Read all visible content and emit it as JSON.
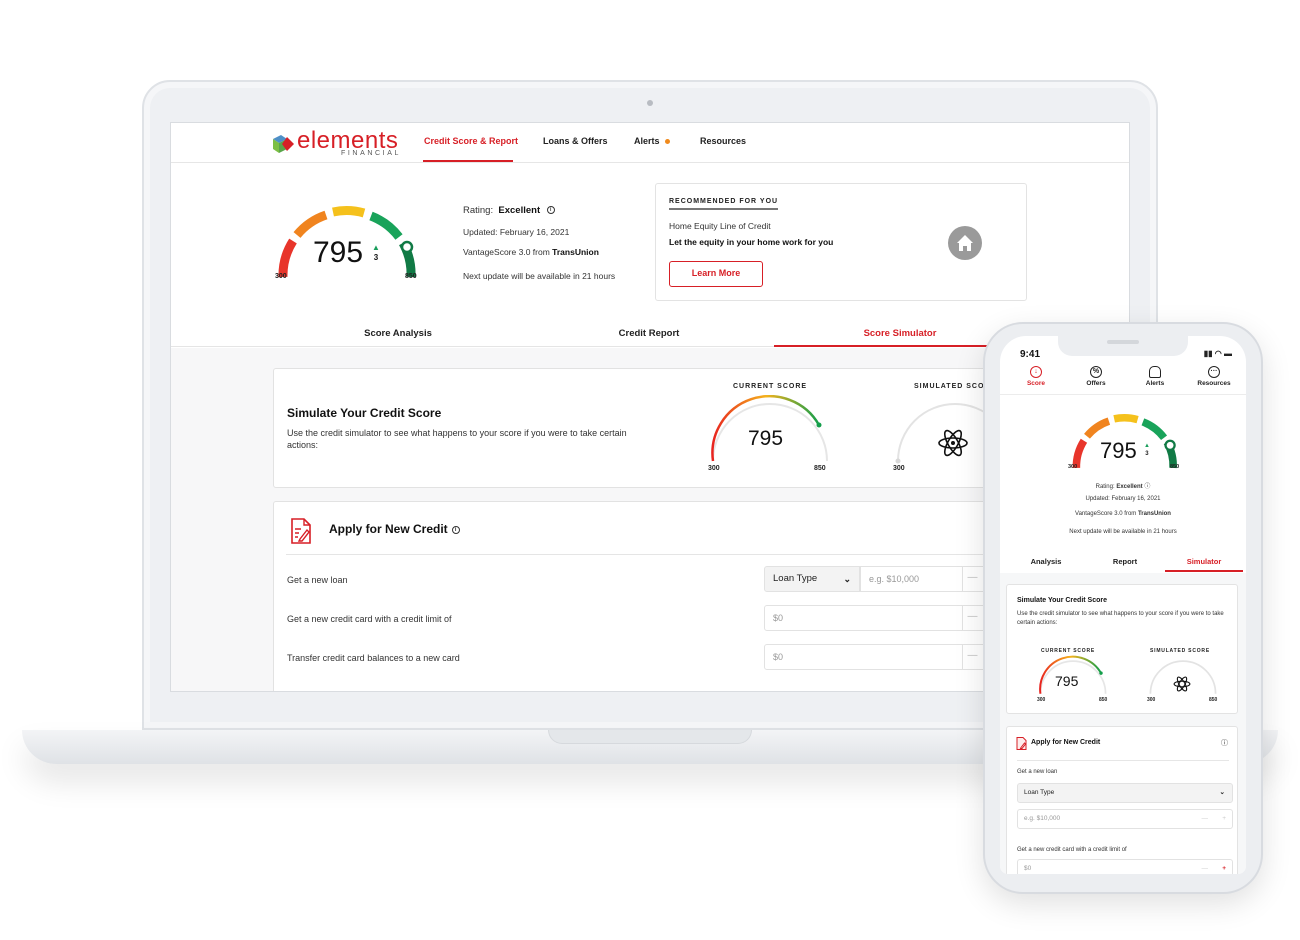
{
  "brand": {
    "name": "elements",
    "sub": "FINANCIAL",
    "accent": "#d71f26"
  },
  "nav": {
    "items": [
      {
        "label": "Credit Score & Report",
        "active": true
      },
      {
        "label": "Loans & Offers"
      },
      {
        "label": "Alerts",
        "badge": "dot"
      },
      {
        "label": "Resources"
      }
    ]
  },
  "score": {
    "value": "795",
    "delta": "3",
    "delta_direction": "up",
    "min": "300",
    "max": "850",
    "rating_label": "Rating:",
    "rating": "Excellent",
    "updated": "Updated: February 16, 2021",
    "source_prefix": "VantageScore 3.0 from",
    "source_bureau": "TransUnion",
    "next_update": "Next update will be available in 21 hours"
  },
  "recommended": {
    "title": "RECOMMENDED FOR YOU",
    "product": "Home Equity Line of Credit",
    "tagline": "Let the equity in your home work for you",
    "button": "Learn More",
    "icon": "house-icon"
  },
  "tabs": [
    {
      "label": "Score Analysis"
    },
    {
      "label": "Credit Report"
    },
    {
      "label": "Score Simulator",
      "active": true
    }
  ],
  "simulator": {
    "title": "Simulate Your Credit Score",
    "description": "Use the credit simulator to see what happens to your score if you were to take certain actions:",
    "current_label": "CURRENT SCORE",
    "simulated_label": "SIMULATED SCORE",
    "current_value": "795",
    "min": "300",
    "max": "850"
  },
  "apply": {
    "title": "Apply for New Credit",
    "rows": [
      {
        "label": "Get a new loan",
        "select": "Loan Type",
        "placeholder": "e.g. $10,000"
      },
      {
        "label": "Get a new credit card with a credit limit of",
        "placeholder": "$0"
      },
      {
        "label": "Transfer credit card balances to a new card",
        "placeholder": "$0"
      }
    ],
    "minus": "—",
    "plus": "+"
  },
  "phone": {
    "time": "9:41",
    "nav": [
      {
        "label": "Score",
        "active": true
      },
      {
        "label": "Offers"
      },
      {
        "label": "Alerts"
      },
      {
        "label": "Resources"
      }
    ],
    "tabs": [
      {
        "label": "Analysis"
      },
      {
        "label": "Report"
      },
      {
        "label": "Simulator",
        "active": true
      }
    ],
    "apply_rows": [
      {
        "label": "Get a new loan",
        "select": "Loan Type",
        "placeholder": "e.g. $10,000"
      },
      {
        "label": "Get a new credit card with a credit limit of",
        "placeholder": "$0"
      }
    ]
  }
}
